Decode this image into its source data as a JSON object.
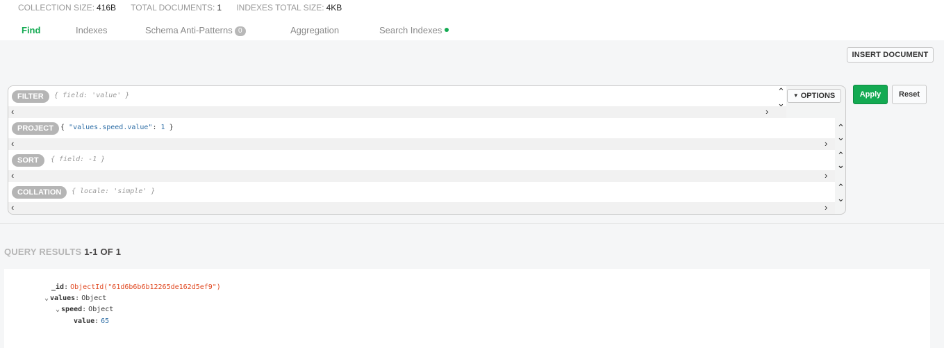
{
  "stats": [
    {
      "label": "COLLECTION SIZE:",
      "value": "416B"
    },
    {
      "label": "TOTAL DOCUMENTS:",
      "value": "1"
    },
    {
      "label": "INDEXES TOTAL SIZE:",
      "value": "4KB"
    }
  ],
  "tabs": {
    "find": "Find",
    "indexes": "Indexes",
    "schema": "Schema Anti-Patterns",
    "schema_badge": "0",
    "aggregation": "Aggregation",
    "search_indexes": "Search Indexes"
  },
  "toolbar": {
    "insert_label": "INSERT DOCUMENT",
    "options_label": "OPTIONS",
    "apply_label": "Apply",
    "reset_label": "Reset"
  },
  "query": {
    "filter": {
      "label": "FILTER",
      "placeholder": "{ field: 'value' }"
    },
    "project": {
      "label": "PROJECT",
      "brace_open": "{ ",
      "key": "\"values.speed.value\"",
      "sep": ": ",
      "value": "1",
      "brace_close": " }"
    },
    "sort": {
      "label": "SORT",
      "placeholder": "{ field: -1 }"
    },
    "collation": {
      "label": "COLLATION",
      "placeholder": "{ locale: 'simple' }"
    }
  },
  "results": {
    "title": "QUERY RESULTS",
    "count": "1-1 OF 1"
  },
  "document": {
    "id_key": "_id",
    "id_value": "ObjectId(\"61d6b6b6b12265de162d5ef9\")",
    "values_key": "values",
    "values_type": "Object",
    "speed_key": "speed",
    "speed_type": "Object",
    "value_key": "value",
    "value_val": "65"
  },
  "colors": {
    "accent": "#13aa52",
    "objectid": "#e0471f",
    "pill": "#b5b5b5"
  }
}
